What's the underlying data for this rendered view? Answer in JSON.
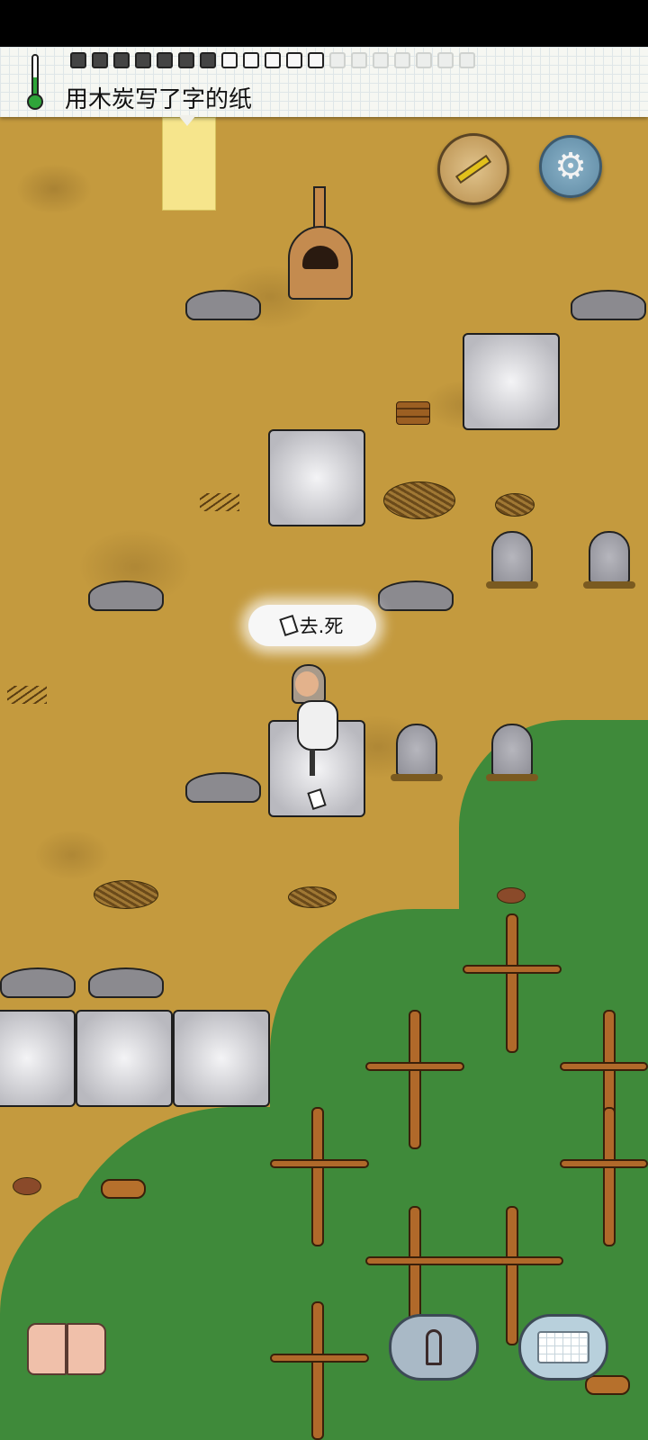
{
  "hud": {
    "held_item_label": "用木炭写了字的纸",
    "food_pips": {
      "filled": 7,
      "empty": 5,
      "faint": 7
    },
    "temperature_indicator": "thermometer-icon"
  },
  "world": {
    "speech_bubble_text": "去.死",
    "speech_icon": "paper-note-icon"
  },
  "controls": {
    "compass": "compass-icon",
    "settings": "gear-icon",
    "tech_book": "book-icon",
    "emote": "emote-puppet-icon",
    "keyboard": "keyboard-icon"
  },
  "colors": {
    "dirt": "#c49a3e",
    "grass": "#3f8a3a",
    "thermometer_green": "#2fa53a",
    "settings_blue": "#6f97b0"
  }
}
